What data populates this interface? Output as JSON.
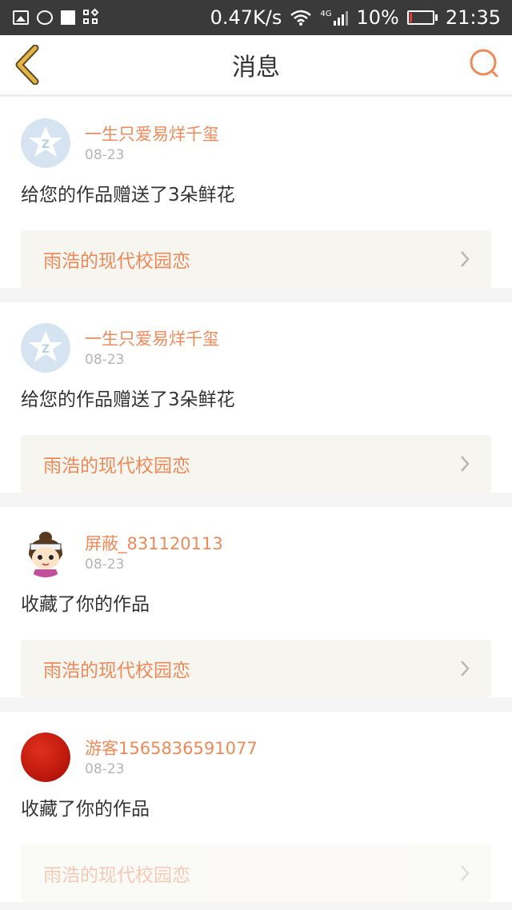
{
  "status_bar": {
    "net_speed": "0.47K/s",
    "network": "4G",
    "battery": "10%",
    "battery_level": 0.1,
    "time": "21:35"
  },
  "header": {
    "title": "消息",
    "back_icon": "chevron-left-icon",
    "search_icon": "search-icon"
  },
  "colors": {
    "accent": "#ec8a5a",
    "back_arrow": "#e5b544",
    "card_link_bg": "#f6f5ef"
  },
  "messages": [
    {
      "username": "一生只爱易烊千玺",
      "date": "08-23",
      "action": "给您的作品赠送了3朵鲜花",
      "work_title": "雨浩的现代校园恋",
      "avatar": "qq-default-avatar"
    },
    {
      "username": "一生只爱易烊千玺",
      "date": "08-23",
      "action": "给您的作品赠送了3朵鲜花",
      "work_title": "雨浩的现代校园恋",
      "avatar": "qq-default-avatar"
    },
    {
      "username": "屏蔽_831120113",
      "date": "08-23",
      "action": "收藏了你的作品",
      "work_title": "雨浩的现代校园恋",
      "avatar": "cartoon-girl-avatar"
    },
    {
      "username": "游客1565836591077",
      "date": "08-23",
      "action": "收藏了你的作品",
      "work_title": "雨浩的现代校园恋",
      "avatar": "red-circle-avatar"
    }
  ]
}
